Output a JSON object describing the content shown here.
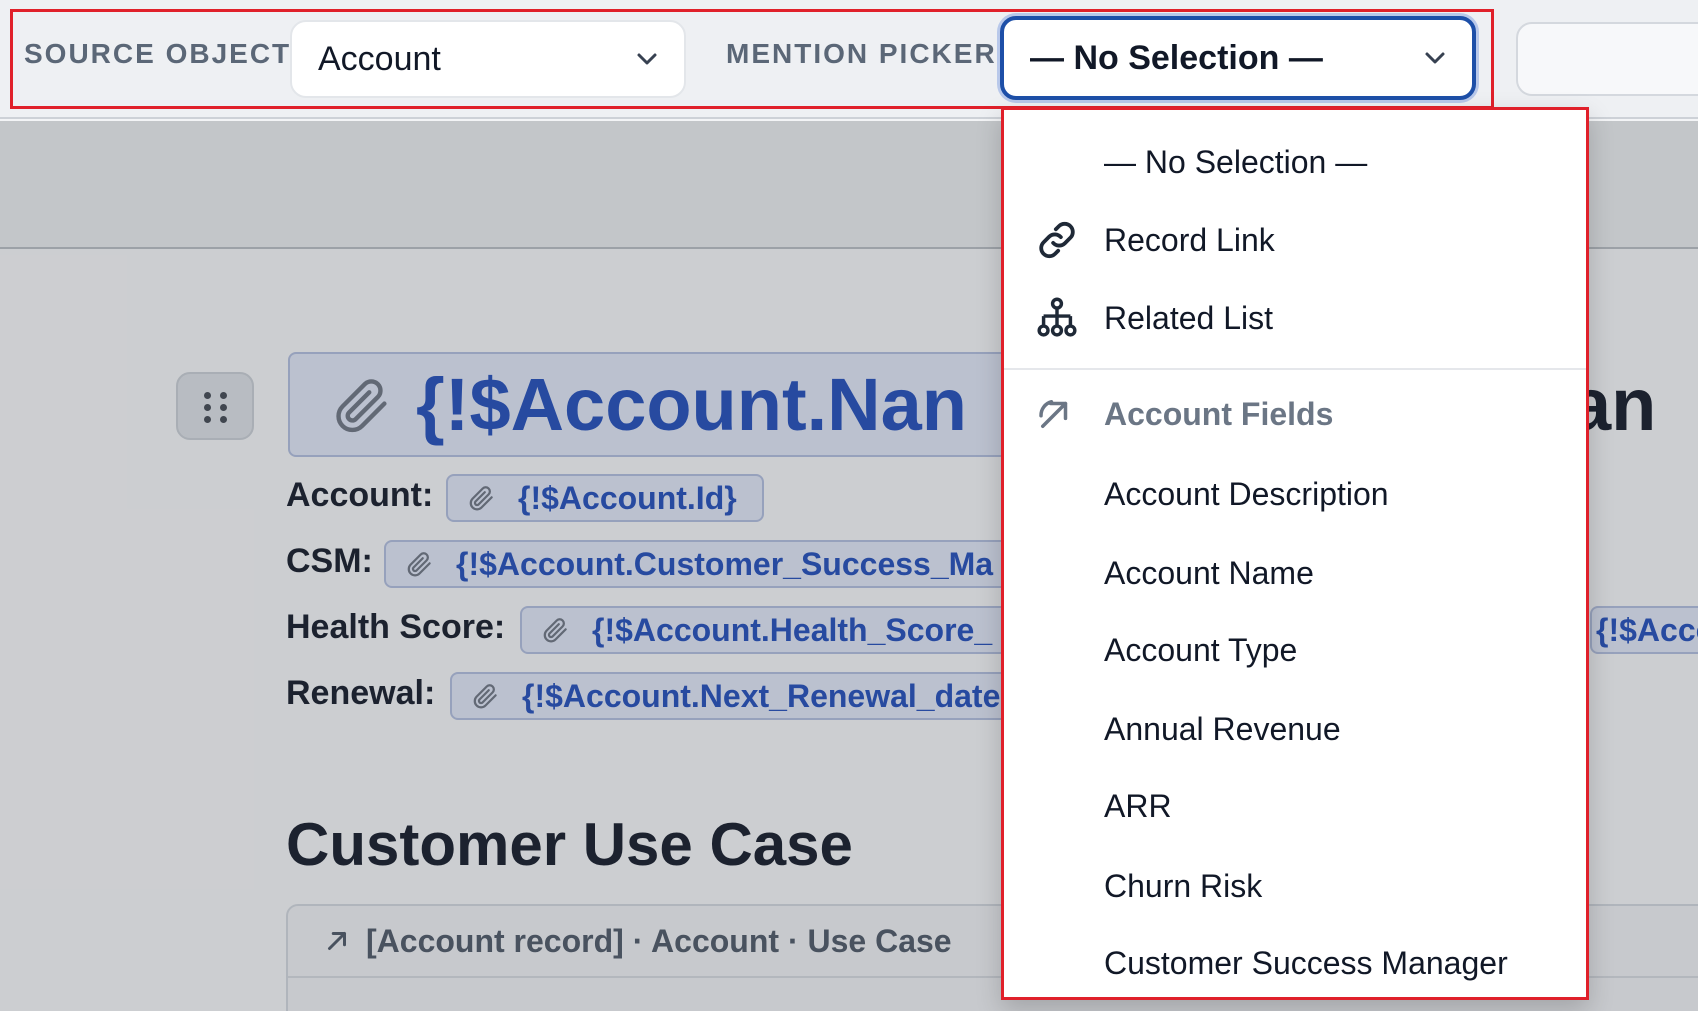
{
  "toolbar": {
    "source_label": "SOURCE OBJECT",
    "source_value": "Account",
    "mention_label": "MENTION PICKER",
    "mention_value": "— No Selection —"
  },
  "document": {
    "title_chip": "{!$Account.Nan",
    "title_tail": "an",
    "fields": [
      {
        "label": "Account:",
        "value": "{!$Account.Id}"
      },
      {
        "label": "CSM:",
        "value": "{!$Account.Customer_Success_Ma"
      },
      {
        "label": "Health Score:",
        "value": "{!$Account.Health_Score_",
        "extra": "{!$Acco"
      },
      {
        "label": "Renewal:",
        "value": "{!$Account.Next_Renewal_date"
      }
    ],
    "section_heading": "Customer Use Case",
    "card_header": "[Account record] · Account · Use Case"
  },
  "dropdown": {
    "items": [
      {
        "label": "— No Selection —",
        "icon": ""
      },
      {
        "label": "Record Link",
        "icon": "link-icon"
      },
      {
        "label": "Related List",
        "icon": "hierarchy-icon"
      }
    ],
    "group": {
      "label": "Account Fields",
      "icon": "arrow-up-right-icon"
    },
    "fields": [
      "Account Description",
      "Account Name",
      "Account Type",
      "Annual Revenue",
      "ARR",
      "Churn Risk",
      "Customer Success Manager"
    ]
  },
  "colors": {
    "accent": "#1d4fa8",
    "chip_text": "#1f4bb8",
    "highlight": "#e0202a"
  }
}
